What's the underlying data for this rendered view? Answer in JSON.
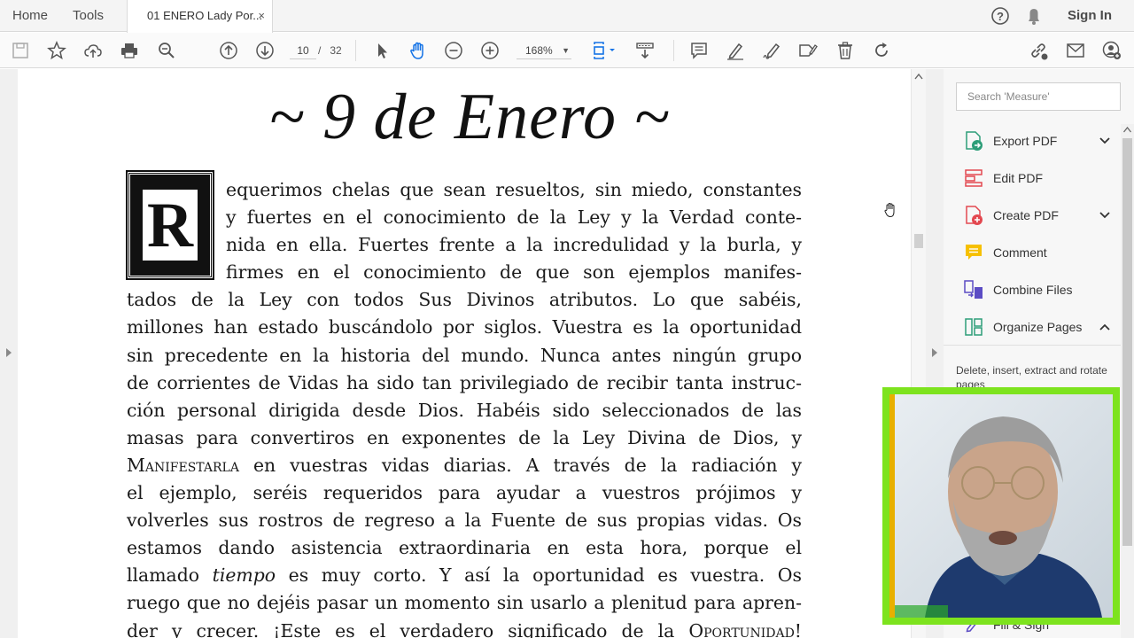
{
  "topbar": {
    "home": "Home",
    "tools": "Tools",
    "tab_title": "01 ENERO Lady Por...",
    "tab_close": "×",
    "sign_in": "Sign In"
  },
  "toolbar": {
    "current_page": "10",
    "page_sep": "/",
    "total_pages": "32",
    "zoom": "168%"
  },
  "document": {
    "title": "~ 9 de Enero ~",
    "dropcap": "R",
    "lines": [
      "equerimos chelas que sean resueltos, sin miedo, constantes",
      "y fuertes en el conocimiento de la Ley y la Verdad conte-",
      "nida en ella. Fuertes frente a la incredulidad y la burla, y",
      "firmes en el conocimiento de que son ejemplos manifes-",
      "tados de la Ley con todos Sus Divinos atributos. Lo que sabéis,",
      "millones han estado buscándolo por siglos. Vuestra es la oportunidad",
      "sin precedente en la historia del mundo. Nunca antes ningún grupo",
      "de corrientes de Vidas ha sido tan privilegiado de recibir tanta instruc-",
      "ción personal dirigida desde Dios. Habéis sido seleccionados de las",
      "masas para convertiros en exponentes de la Ley Divina de Dios, y"
    ],
    "line11_sc": "Manifestarla",
    "line11_rest": " en vuestras vidas diarias. A través de la radiación y",
    "lines_b": [
      "el ejemplo, seréis requeridos para ayudar a vuestros prójimos y",
      "volverles sus rostros de regreso a la Fuente de sus propias vidas. Os",
      "estamos dando asistencia extraordinaria en esta hora, porque el"
    ],
    "line15_a": "llamado ",
    "line15_it": "tiempo",
    "line15_b": " es muy corto. Y así la oportunidad es vuestra. Os",
    "line16": "ruego que no dejéis pasar un momento sin usarlo a plenitud para apren-",
    "line17_a": "der y crecer. ¡Este es el verdadero significado de la ",
    "line17_sc": "Oportunidad",
    "line17_b": "!"
  },
  "rightpane": {
    "search_placeholder": "Search 'Measure'",
    "items": [
      {
        "label": "Export PDF",
        "chev": "⌄"
      },
      {
        "label": "Edit PDF",
        "chev": ""
      },
      {
        "label": "Create PDF",
        "chev": "⌄"
      },
      {
        "label": "Comment",
        "chev": ""
      },
      {
        "label": "Combine Files",
        "chev": ""
      },
      {
        "label": "Organize Pages",
        "chev": "⌃"
      }
    ],
    "desc": "Delete, insert, extract and rotate pages",
    "fill_sign": "Fill & Sign"
  }
}
